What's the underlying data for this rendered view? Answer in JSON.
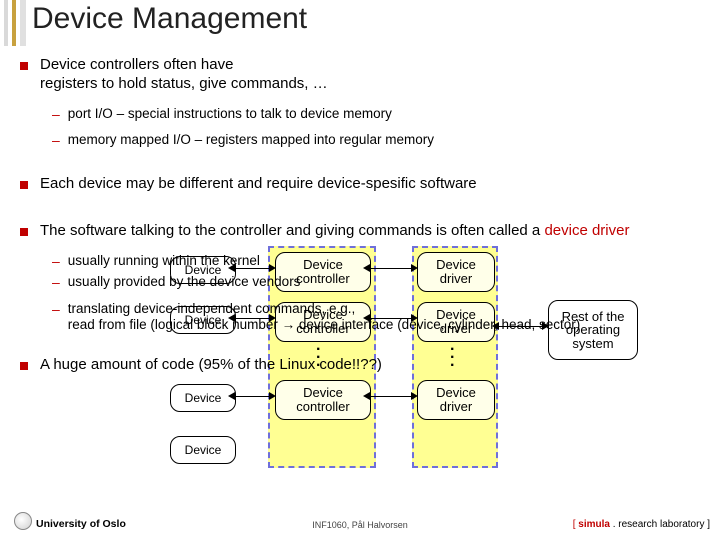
{
  "title": "Device Management",
  "bullets": {
    "b1": {
      "line1": "Device controllers often have",
      "line2": "registers to hold status, give commands, …",
      "sub1": "port I/O – special instructions to talk to device memory",
      "sub2": "memory mapped I/O – registers mapped into regular memory"
    },
    "b2": "Each device may be different and require device-spesific software",
    "b3": {
      "pre": "The software talking to the controller and giving commands is often called a ",
      "em": "device driver",
      "sub1": "usually running within the kernel",
      "sub2": "usually provided by the device vendors",
      "sub3a": "translating device-independent commands, e.g.,",
      "sub3b": "read from file (logical block number → device interface (device, cylinder, head, sector)"
    },
    "b4": "A huge amount of code (95% of the Linux code!!??)"
  },
  "diagram": {
    "device": "Device",
    "controller": "Device controller",
    "driver": "Device driver",
    "rest": "Rest of the operating system"
  },
  "footer": {
    "uio": "University of Oslo",
    "center": "INF1060, Pål Halvorsen",
    "simula_pre": "[ ",
    "simula_em": "simula",
    "simula_post": " . research laboratory ]"
  }
}
